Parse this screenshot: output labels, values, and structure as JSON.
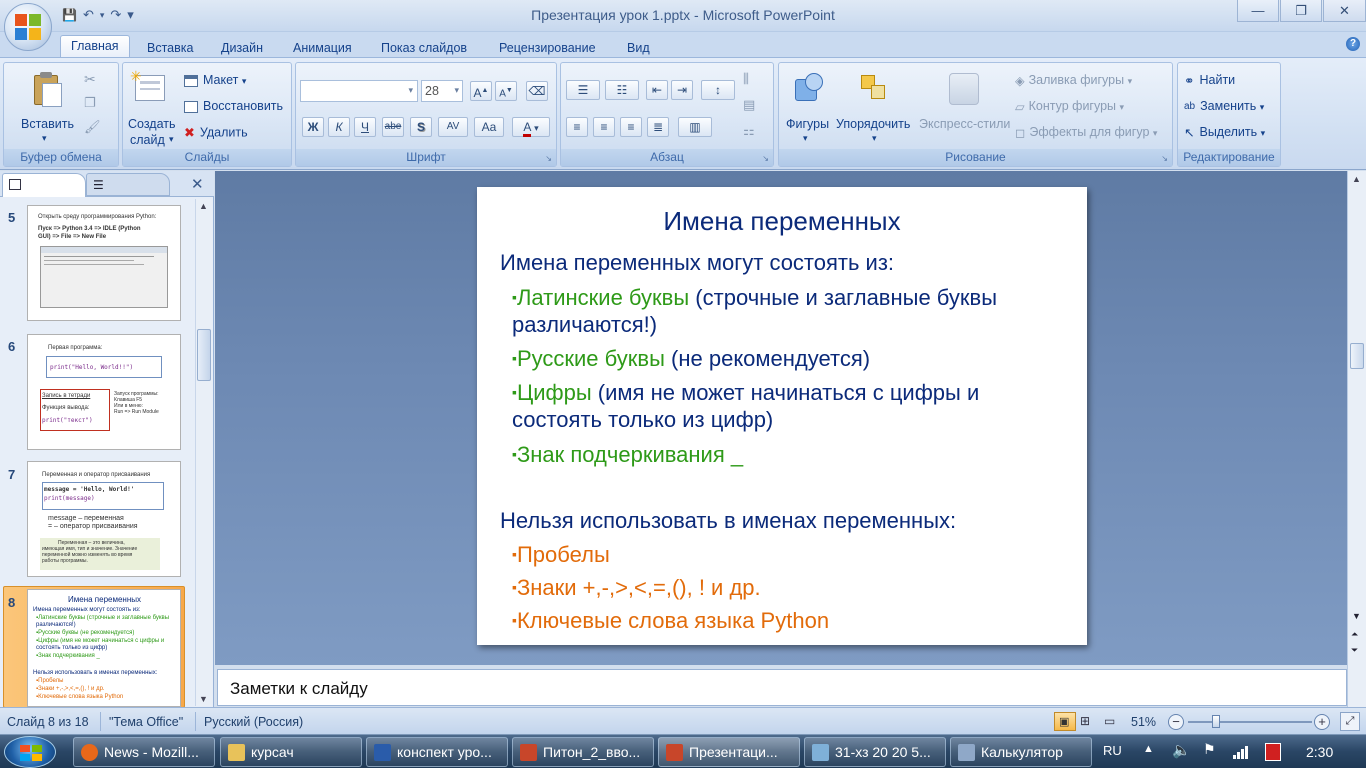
{
  "window": {
    "title": "Презентация урок 1.pptx - Microsoft PowerPoint",
    "minimize": "—",
    "maximize": "❐",
    "close": "✕"
  },
  "qat": {
    "save": "💾",
    "undo": "↶",
    "redo": "↷",
    "customize": "▾"
  },
  "tabs": [
    {
      "label": "Главная",
      "active": true
    },
    {
      "label": "Вставка"
    },
    {
      "label": "Дизайн"
    },
    {
      "label": "Анимация"
    },
    {
      "label": "Показ слайдов"
    },
    {
      "label": "Рецензирование"
    },
    {
      "label": "Вид"
    }
  ],
  "ribbon": {
    "clipboard": {
      "label": "Буфер обмена",
      "paste": "Вставить"
    },
    "slides": {
      "label": "Слайды",
      "new_slide_1": "Создать",
      "new_slide_2": "слайд",
      "layout": "Макет",
      "reset": "Восстановить",
      "delete": "Удалить"
    },
    "font": {
      "label": "Шрифт",
      "size": "28",
      "bold": "Ж",
      "italic": "К",
      "underline": "Ч",
      "strike": "abe",
      "shadow": "S",
      "spacing": "AV",
      "case": "Aa",
      "color": "A",
      "grow": "A",
      "shrink": "A"
    },
    "paragraph": {
      "label": "Абзац"
    },
    "drawing": {
      "label": "Рисование",
      "shapes": "Фигуры",
      "arrange": "Упорядочить",
      "quick_styles": "Экспресс-стили",
      "fill": "Заливка фигуры",
      "outline": "Контур фигуры",
      "effects": "Эффекты для фигур"
    },
    "editing": {
      "label": "Редактирование",
      "find": "Найти",
      "replace": "Заменить",
      "select": "Выделить"
    }
  },
  "slide_pane": {
    "thumbs": [
      {
        "num": "5",
        "lines": [
          "Открыть среду программирования Python:",
          "Пуск   =>   Python 3.4   =>   IDLE (Python",
          "GUI)   =>   File   =>   New File"
        ]
      },
      {
        "num": "6",
        "lines": [
          "Первая программа:",
          "print(\"Hello, World!!\")",
          "Запись в тетради",
          "Функция вывода:",
          "print(\"текст\")",
          "Запуск программы:",
          "Клавиша F5",
          "Или в меню:",
          "Run  =>  Run Module"
        ]
      },
      {
        "num": "7",
        "lines": [
          "Переменная и оператор присваивания",
          "message = 'Hello, World!'",
          "print(message)",
          "message – переменная",
          "= – оператор присваивания",
          "Переменная – это величина,",
          "имеющая имя, тип и значение. Значение",
          "переменной можно изменять во время",
          "работы программы."
        ]
      },
      {
        "num": "8",
        "lines": [
          "Имена переменных",
          "Имена переменных могут состоять из:",
          "▪Латинские буквы (строчные и заглавные буквы",
          "различаются!)",
          "▪Русские буквы (не рекомендуется)",
          "▪Цифры (имя не может начинаться с цифры и",
          "состоять только из цифр)",
          "▪Знак подчеркивания _",
          "Нельзя использовать в именах переменных:",
          "▪Пробелы",
          "▪Знаки +,-,>,<,=,(), ! и др.",
          "▪Ключевые слова языка Python"
        ]
      }
    ]
  },
  "slide": {
    "title": "Имена переменных",
    "heading1": "Имена переменных могут состоять из:",
    "b1_green": "Латинские буквы",
    "b1_rest": " (строчные и заглавные буквы",
    "b1_line2": "различаются!)",
    "b2_green": "Русские буквы",
    "b2_rest": " (не рекомендуется)",
    "b3_green": "Цифры",
    "b3_rest": " (имя не может начинаться с цифры и",
    "b3_line2": "состоять только из цифр)",
    "b4_green": "Знак подчеркивания _",
    "heading2": "Нельзя использовать в именах переменных:",
    "o1": "Пробелы",
    "o2": "Знаки +,-,>,<,=,(), ! и др.",
    "o3": "Ключевые слова языка Python",
    "bullet": "▪"
  },
  "notes": {
    "placeholder": "Заметки к слайду"
  },
  "status": {
    "slide": "Слайд 8 из 18",
    "theme": "\"Тема Office\"",
    "lang": "Русский (Россия)",
    "zoom": "51%"
  },
  "taskbar": {
    "items": [
      {
        "label": "News - Mozill...",
        "color": "#e8681a"
      },
      {
        "label": "курсач",
        "color": "#e8c25a"
      },
      {
        "label": "конспект уро...",
        "color": "#2a5caa"
      },
      {
        "label": "Питон_2_вво...",
        "color": "#c8462a"
      },
      {
        "label": "Презентаци...",
        "color": "#c8462a",
        "active": true
      },
      {
        "label": "31-хз 20 20 5...",
        "color": "#7fb0d8"
      },
      {
        "label": "Калькулятор",
        "color": "#8fa8c8"
      }
    ],
    "lang": "RU",
    "time": "2:30"
  },
  "colors": {
    "navy": "#0b2a7a",
    "green": "#2e9a18",
    "orange": "#e26b0a"
  }
}
